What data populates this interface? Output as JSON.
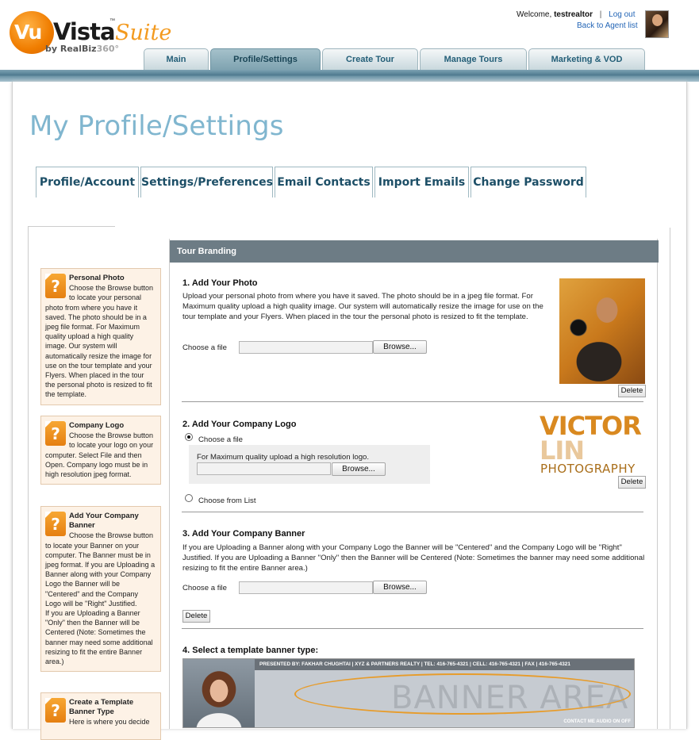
{
  "header": {
    "logo": {
      "vu": "Vu",
      "vista": "Vista",
      "tm": "™",
      "suite": "Suite",
      "by": "by RealBiz",
      "by_suffix": "360°"
    },
    "welcome_prefix": "Welcome,",
    "username": "testrealtor",
    "separator": "|",
    "logout_label": "Log out",
    "back_label": "Back to Agent list"
  },
  "nav": {
    "tabs": [
      {
        "label": "Main"
      },
      {
        "label": "Profile/Settings"
      },
      {
        "label": "Create Tour"
      },
      {
        "label": "Manage Tours"
      },
      {
        "label": "Marketing & VOD"
      }
    ],
    "active": "Profile/Settings"
  },
  "page": {
    "title": "My Profile/Settings",
    "subtabs": [
      {
        "label": "Profile/Account"
      },
      {
        "label": "Settings/Preferences"
      },
      {
        "label": "Email Contacts"
      },
      {
        "label": "Import Emails"
      },
      {
        "label": "Change Password"
      }
    ]
  },
  "help": [
    {
      "title": "Personal Photo",
      "text": "Choose the Browse button to locate your personal photo from where you have it saved. The photo should be in a jpeg file format. For Maximum quality upload a high quality image. Our system will automatically resize the image for use on the tour template and your Flyers. When placed in the tour the personal photo is resized to fit the template."
    },
    {
      "title": "Company Logo",
      "text": "Choose the Browse button to locate your logo on your computer. Select File and then Open. Company logo must be in high resolution jpeg format."
    },
    {
      "title": "Add Your Company Banner",
      "text": "Choose the Browse button to locate your Banner on your computer. The Banner must be in jpeg format. If you are Uploading a Banner along with your Company Logo the Banner will be \"Centered\" and the Company Logo will be \"Right\" Justified.",
      "text2": "If you are Uploading a Banner \"Only\" then the Banner will be Centered (Note: Sometimes the banner may need some additional resizing to fit the entire Banner area.)"
    },
    {
      "title": "Create a Template Banner Type",
      "text": "Here is where you decide"
    }
  ],
  "branding": {
    "header": "Tour Branding",
    "photo": {
      "title": "1. Add Your Photo",
      "text": "Upload your personal photo from where you have it saved. The photo should be in a jpeg file format. For Maximum quality upload a high quality image. Our system will automatically resize the image for use on the tour template and your Flyers. When placed in the tour the personal photo is resized to fit the template.",
      "choose_label": "Choose a file",
      "browse_label": "Browse...",
      "delete_label": "Delete"
    },
    "logo": {
      "title": "2. Add Your Company Logo",
      "choose_file_label": "Choose a file",
      "hint": "For Maximum quality upload a high resolution logo.",
      "browse_label": "Browse...",
      "choose_list_label": "Choose from List",
      "delete_label": "Delete",
      "logo_line1": "VICTOR",
      "logo_line2": "LIN",
      "logo_line3": "PHOTOGRAPHY",
      "selected_option": "Choose a file"
    },
    "banner": {
      "title": "3. Add Your Company Banner",
      "text": "If you are Uploading a Banner along with your Company Logo the Banner will be \"Centered\" and the Company Logo will be \"Right\" Justified. If you are Uploading a Banner \"Only\" then the Banner will be Centered (Note: Sometimes the banner may need some additional resizing to fit the entire Banner area.)",
      "choose_label": "Choose a file",
      "browse_label": "Browse...",
      "delete_label": "Delete"
    },
    "template": {
      "title": "4. Select a template banner type:",
      "preview_top": "PRESENTED BY: FAKHAR CHUGHTAI  |  XYZ & PARTNERS REALTY  |  TEL: 416-765-4321  |  CELL: 416-765-4321  |  FAX  |  416-765-4321",
      "preview_area": "BANNER AREA",
      "preview_foot": "CONTACT ME     AUDIO  ON  OFF"
    }
  }
}
